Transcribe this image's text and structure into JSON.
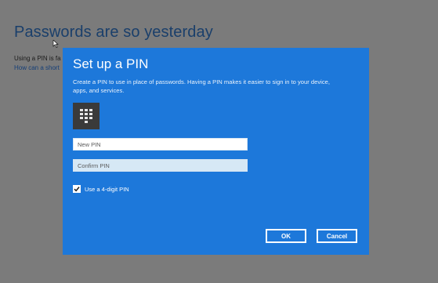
{
  "background": {
    "title": "Passwords are so yesterday",
    "line1": "Using a PIN is fa",
    "link": "How can a short"
  },
  "dialog": {
    "title": "Set up a PIN",
    "description": "Create a PIN to use in place of passwords. Having a PIN makes it easier to sign in to your device, apps, and services.",
    "new_pin_placeholder": "New PIN",
    "confirm_pin_placeholder": "Confirm PIN",
    "checkbox_label": "Use a 4-digit PIN",
    "checkbox_checked": true,
    "ok_label": "OK",
    "cancel_label": "Cancel",
    "icon": "keypad-icon",
    "accent_color": "#1d78da"
  }
}
